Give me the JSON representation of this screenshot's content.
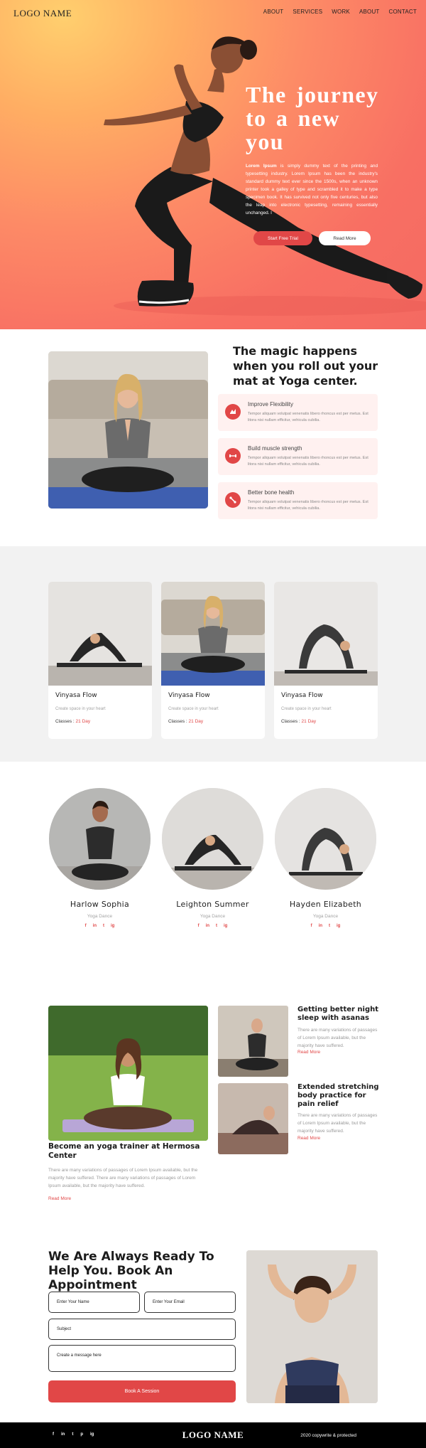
{
  "header": {
    "logo": "LOGO NAME",
    "nav": [
      "ABOUT",
      "SERVICES",
      "WORK",
      "ABOUT",
      "CONTACT"
    ]
  },
  "hero": {
    "title": "The journey to a new you",
    "text_bold": "Lorem Ipsum",
    "text": " is simply dummy text of the printing and typesetting industry. Lorem Ipsum has been the industry's standard dummy text ever since the 1500s, when an unknown printer took a galley of type and scrambled it to make a type specimen book. It has survived not only five centuries, but also the leap into electronic typesetting, remaining essentially unchanged. I",
    "primary_button": "Start Free Trial",
    "secondary_button": "Read More"
  },
  "magic": {
    "title": "The magic happens when you roll out your mat at Yoga center.",
    "features": [
      {
        "title": "Improve Flexibility",
        "text": "Tempor aliquam volutpat venenatis libero rhoncus est per metus. Est litora nisi nullam efficitur, vehicula cubilia.",
        "icon": "flexibility-icon"
      },
      {
        "title": "Build muscle strength",
        "text": "Tempor aliquam volutpat venenatis libero rhoncus est per metus. Est litora nisi nullam efficitur, vehicula cubilia.",
        "icon": "dumbbell-icon"
      },
      {
        "title": "Better bone health",
        "text": "Tempor aliquam volutpat venenatis libero rhoncus est per metus. Est litora nisi nullam efficitur, vehicula cubilia.",
        "icon": "bone-icon"
      }
    ]
  },
  "classes": [
    {
      "title": "Vinyasa Flow",
      "subtitle": "Create space in your heart",
      "label": "Classes : ",
      "duration": "21 Day"
    },
    {
      "title": "Vinyasa Flow",
      "subtitle": "Create space in your heart",
      "label": "Classes : ",
      "duration": "21 Day"
    },
    {
      "title": "Vinyasa Flow",
      "subtitle": "Create space in your heart",
      "label": "Classes : ",
      "duration": "21 Day"
    }
  ],
  "trainers": [
    {
      "name": "Harlow Sophia",
      "role": "Yoga Dance"
    },
    {
      "name": "Leighton Summer",
      "role": "Yoga Dance"
    },
    {
      "name": "Hayden Elizabeth",
      "role": "Yoga Dance"
    }
  ],
  "social_glyphs": [
    "f",
    "in",
    "t",
    "ig"
  ],
  "blog": {
    "main": {
      "title": "Become an yoga trainer at Hermosa Center",
      "text": "There are many variations of passages of Lorem Ipsum available, but the majority have suffered. There are many variations of passages of Lorem Ipsum available, but the majority have suffered.",
      "more": "Read More"
    },
    "side": [
      {
        "title": "Getting better night sleep with asanas",
        "text": "There are many variations of passages of Lorem Ipsum available, but the majority have suffered.",
        "more": "Read More"
      },
      {
        "title": "Extended stretching body practice for pain relief",
        "text": "There are many variations of passages of Lorem Ipsum available, but the majority have suffered.",
        "more": "Read More"
      }
    ]
  },
  "contact": {
    "title": "We Are Always Ready To Help You. Book An Appointment",
    "name_placeholder": "Enter Your Name",
    "email_placeholder": "Enter Your Email",
    "subject_placeholder": "Subject",
    "message_placeholder": "Create a message here",
    "button": "Book A Session"
  },
  "footer": {
    "logo": "LOGO NAME",
    "copyright": "2020 copywrite & protected",
    "social": [
      "f",
      "in",
      "t",
      "p",
      "ig"
    ]
  },
  "colors": {
    "accent": "#e14747",
    "feature_bg": "#fff1f0",
    "section_gray": "#f2f2f2",
    "footer_bg": "#000000"
  }
}
